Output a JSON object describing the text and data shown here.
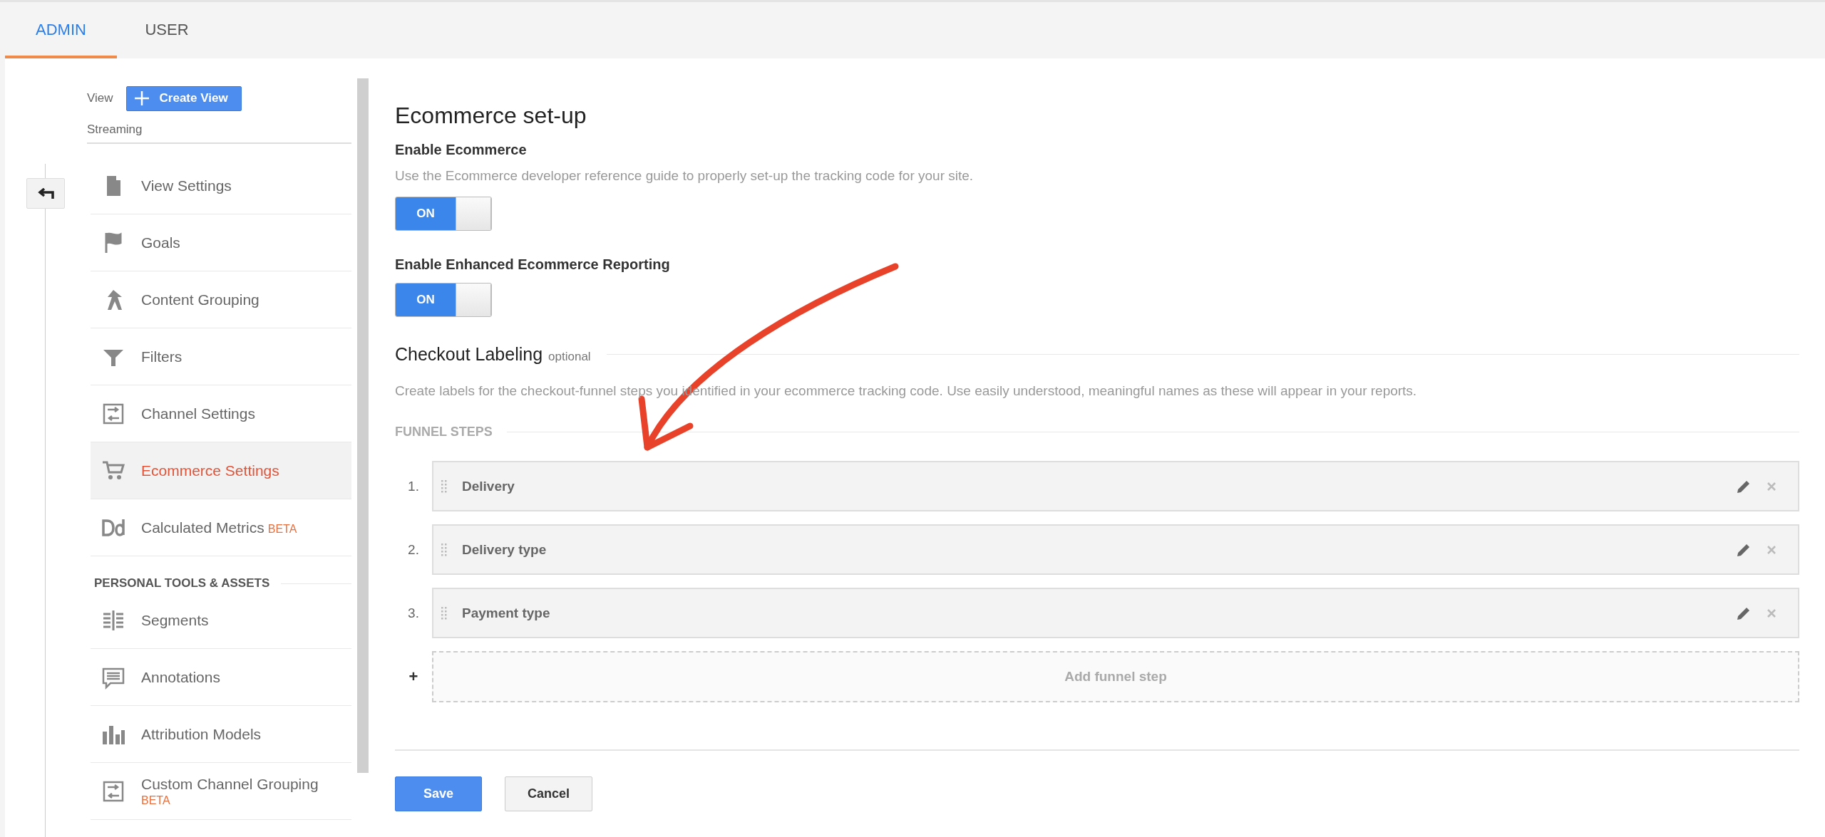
{
  "tabs": [
    {
      "label": "ADMIN",
      "selected": true
    },
    {
      "label": "USER",
      "selected": false
    }
  ],
  "sidebar": {
    "view_label": "View",
    "create_view_button": "Create View",
    "view_name": "Streaming",
    "items": [
      {
        "label": "View Settings",
        "selected": false
      },
      {
        "label": "Goals",
        "selected": false
      },
      {
        "label": "Content Grouping",
        "selected": false
      },
      {
        "label": "Filters",
        "selected": false
      },
      {
        "label": "Channel Settings",
        "selected": false
      },
      {
        "label": "Ecommerce Settings",
        "selected": true
      },
      {
        "label": "Calculated Metrics",
        "badge": "BETA",
        "selected": false
      }
    ],
    "section_header": "PERSONAL TOOLS & ASSETS",
    "personal_items": [
      {
        "label": "Segments",
        "selected": false
      },
      {
        "label": "Annotations",
        "selected": false
      },
      {
        "label": "Attribution Models",
        "selected": false
      },
      {
        "label": "Custom Channel Grouping",
        "badge": "BETA",
        "selected": false
      }
    ]
  },
  "main": {
    "title": "Ecommerce set-up",
    "settings": [
      {
        "label": "Enable Ecommerce",
        "description": "Use the Ecommerce developer reference guide to properly set-up the tracking code for your site.",
        "toggle_text": "ON",
        "on": true
      },
      {
        "label": "Enable Enhanced Ecommerce Reporting",
        "toggle_text": "ON",
        "on": true
      }
    ],
    "checkout_labeling": {
      "title": "Checkout Labeling",
      "optional": "optional",
      "description": "Create labels for the checkout-funnel steps you identified in your ecommerce tracking code. Use easily understood, meaningful names as these will appear in your reports."
    },
    "funnel_steps_header": "FUNNEL STEPS",
    "funnel_steps": [
      {
        "number": "1.",
        "name": "Delivery"
      },
      {
        "number": "2.",
        "name": "Delivery type"
      },
      {
        "number": "3.",
        "name": "Payment type"
      }
    ],
    "add_step": {
      "plus": "+",
      "label": "Add funnel step"
    },
    "buttons": [
      {
        "label": "Save",
        "kind": "primary"
      },
      {
        "label": "Cancel",
        "kind": "secondary"
      }
    ]
  }
}
